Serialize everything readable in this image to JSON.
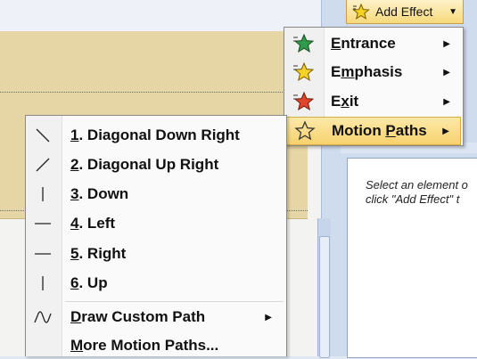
{
  "add_effect": {
    "label": "Add Effect",
    "icon": "star-icon"
  },
  "effects_menu": {
    "items": [
      {
        "name": "entrance",
        "accel": "E",
        "rest": "ntrance",
        "icon": "green-star-icon",
        "has_submenu": true
      },
      {
        "name": "emphasis",
        "accel": "m",
        "pre": "E",
        "rest": "phasis",
        "icon": "yellow-star-icon",
        "has_submenu": true
      },
      {
        "name": "exit",
        "pre": "E",
        "accel": "x",
        "rest": "it",
        "icon": "red-star-icon",
        "has_submenu": true
      },
      {
        "name": "motion-paths",
        "pre": "Motion ",
        "accel": "P",
        "rest": "aths",
        "icon": "outline-star-icon",
        "has_submenu": true,
        "selected": true
      }
    ]
  },
  "motion_menu": {
    "items": [
      {
        "num": "1",
        "text": ". Diagonal Down Right",
        "icon": "diagonal-down-right-icon"
      },
      {
        "num": "2",
        "text": ". Diagonal Up Right",
        "icon": "diagonal-up-right-icon"
      },
      {
        "num": "3",
        "text": ". Down",
        "icon": "down-line-icon"
      },
      {
        "num": "4",
        "text": ". Left",
        "icon": "left-line-icon"
      },
      {
        "num": "5",
        "text": ". Right",
        "icon": "right-line-icon"
      },
      {
        "num": "6",
        "text": ". Up",
        "icon": "up-line-icon"
      }
    ],
    "draw_custom": {
      "accel": "D",
      "rest": "raw Custom Path",
      "icon": "custom-path-icon"
    },
    "more": {
      "accel": "M",
      "rest": "ore Motion Paths..."
    }
  },
  "pane": {
    "hint_line1": "Select an element o",
    "hint_line2": "click \"Add Effect\" t"
  },
  "colors": {
    "slide_tan": "#e6d6a5",
    "menu_highlight": "#f7d26d"
  }
}
